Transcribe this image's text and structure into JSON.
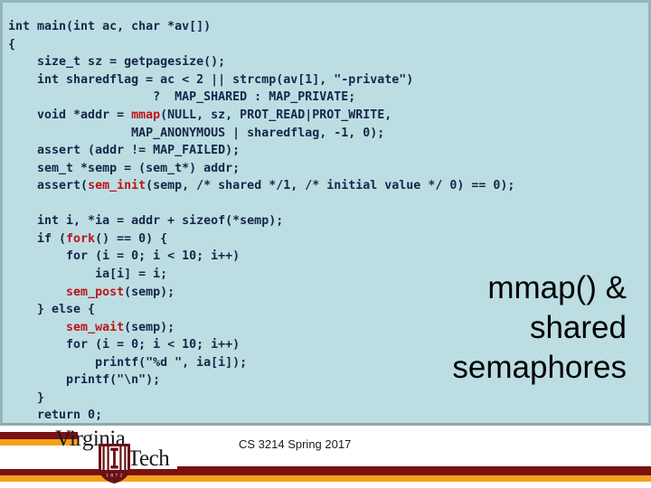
{
  "slide": {
    "title_lines": [
      "mmap() &",
      "shared",
      "semaphores"
    ],
    "background_color": "#bcdee3",
    "code_color": "#16264a",
    "highlight_color": "#c11317"
  },
  "code": {
    "lines": [
      {
        "indent": 0,
        "segments": [
          {
            "text": "int main(int ac, char *av[])",
            "hl": false
          }
        ]
      },
      {
        "indent": 0,
        "segments": [
          {
            "text": "{",
            "hl": false
          }
        ]
      },
      {
        "indent": 0,
        "segments": [
          {
            "text": "    size_t sz = getpagesize();",
            "hl": false
          }
        ]
      },
      {
        "indent": 0,
        "segments": [
          {
            "text": "    int sharedflag = ac < 2 || strcmp(av[1], \"-private\")",
            "hl": false
          }
        ]
      },
      {
        "indent": 0,
        "segments": [
          {
            "text": "                    ?  MAP_SHARED : MAP_PRIVATE;",
            "hl": false
          }
        ]
      },
      {
        "indent": 0,
        "segments": [
          {
            "text": "    void *addr = ",
            "hl": false
          },
          {
            "text": "mmap",
            "hl": true
          },
          {
            "text": "(NULL, sz, PROT_READ|PROT_WRITE,",
            "hl": false
          }
        ]
      },
      {
        "indent": 0,
        "segments": [
          {
            "text": "                 MAP_ANONYMOUS | sharedflag, -1, 0);",
            "hl": false
          }
        ]
      },
      {
        "indent": 0,
        "segments": [
          {
            "text": "    assert (addr != MAP_FAILED);",
            "hl": false
          }
        ]
      },
      {
        "indent": 0,
        "segments": [
          {
            "text": "    sem_t *semp = (sem_t*) addr;",
            "hl": false
          }
        ]
      },
      {
        "indent": 0,
        "segments": [
          {
            "text": "    assert(",
            "hl": false
          },
          {
            "text": "sem_init",
            "hl": true
          },
          {
            "text": "(semp, /* shared */1, /* initial value */ 0) == 0);",
            "hl": false
          }
        ]
      },
      {
        "indent": 0,
        "segments": [
          {
            "text": "",
            "hl": false
          }
        ]
      },
      {
        "indent": 0,
        "segments": [
          {
            "text": "    int i, *ia = addr + sizeof(*semp);",
            "hl": false
          }
        ]
      },
      {
        "indent": 0,
        "segments": [
          {
            "text": "    if (",
            "hl": false
          },
          {
            "text": "fork",
            "hl": true
          },
          {
            "text": "() == 0) {",
            "hl": false
          }
        ]
      },
      {
        "indent": 0,
        "segments": [
          {
            "text": "        for (i = 0; i < 10; i++)",
            "hl": false
          }
        ]
      },
      {
        "indent": 0,
        "segments": [
          {
            "text": "            ia[i] = i;",
            "hl": false
          }
        ]
      },
      {
        "indent": 0,
        "segments": [
          {
            "text": "        ",
            "hl": false
          },
          {
            "text": "sem_post",
            "hl": true
          },
          {
            "text": "(semp);",
            "hl": false
          }
        ]
      },
      {
        "indent": 0,
        "segments": [
          {
            "text": "    } else {",
            "hl": false
          }
        ]
      },
      {
        "indent": 0,
        "segments": [
          {
            "text": "        ",
            "hl": false
          },
          {
            "text": "sem_wait",
            "hl": true
          },
          {
            "text": "(semp);",
            "hl": false
          }
        ]
      },
      {
        "indent": 0,
        "segments": [
          {
            "text": "        for (i = 0; i < 10; i++)",
            "hl": false
          }
        ]
      },
      {
        "indent": 0,
        "segments": [
          {
            "text": "            printf(\"%d \", ia[i]);",
            "hl": false
          }
        ]
      },
      {
        "indent": 0,
        "segments": [
          {
            "text": "        printf(\"\\n\");",
            "hl": false
          }
        ]
      },
      {
        "indent": 0,
        "segments": [
          {
            "text": "    }",
            "hl": false
          }
        ]
      },
      {
        "indent": 0,
        "segments": [
          {
            "text": "    return 0;",
            "hl": false
          }
        ]
      },
      {
        "indent": 0,
        "segments": [
          {
            "text": "}",
            "hl": false
          }
        ]
      }
    ]
  },
  "footer": {
    "course_text": "CS 3214 Spring 2017",
    "logo": {
      "word_top": "Virginia",
      "word_bottom": "Tech",
      "shield_year": "1 8 7 2",
      "shield_monogram": "VT"
    },
    "colors": {
      "maroon": "#7b1113",
      "orange": "#f5a11b"
    }
  }
}
